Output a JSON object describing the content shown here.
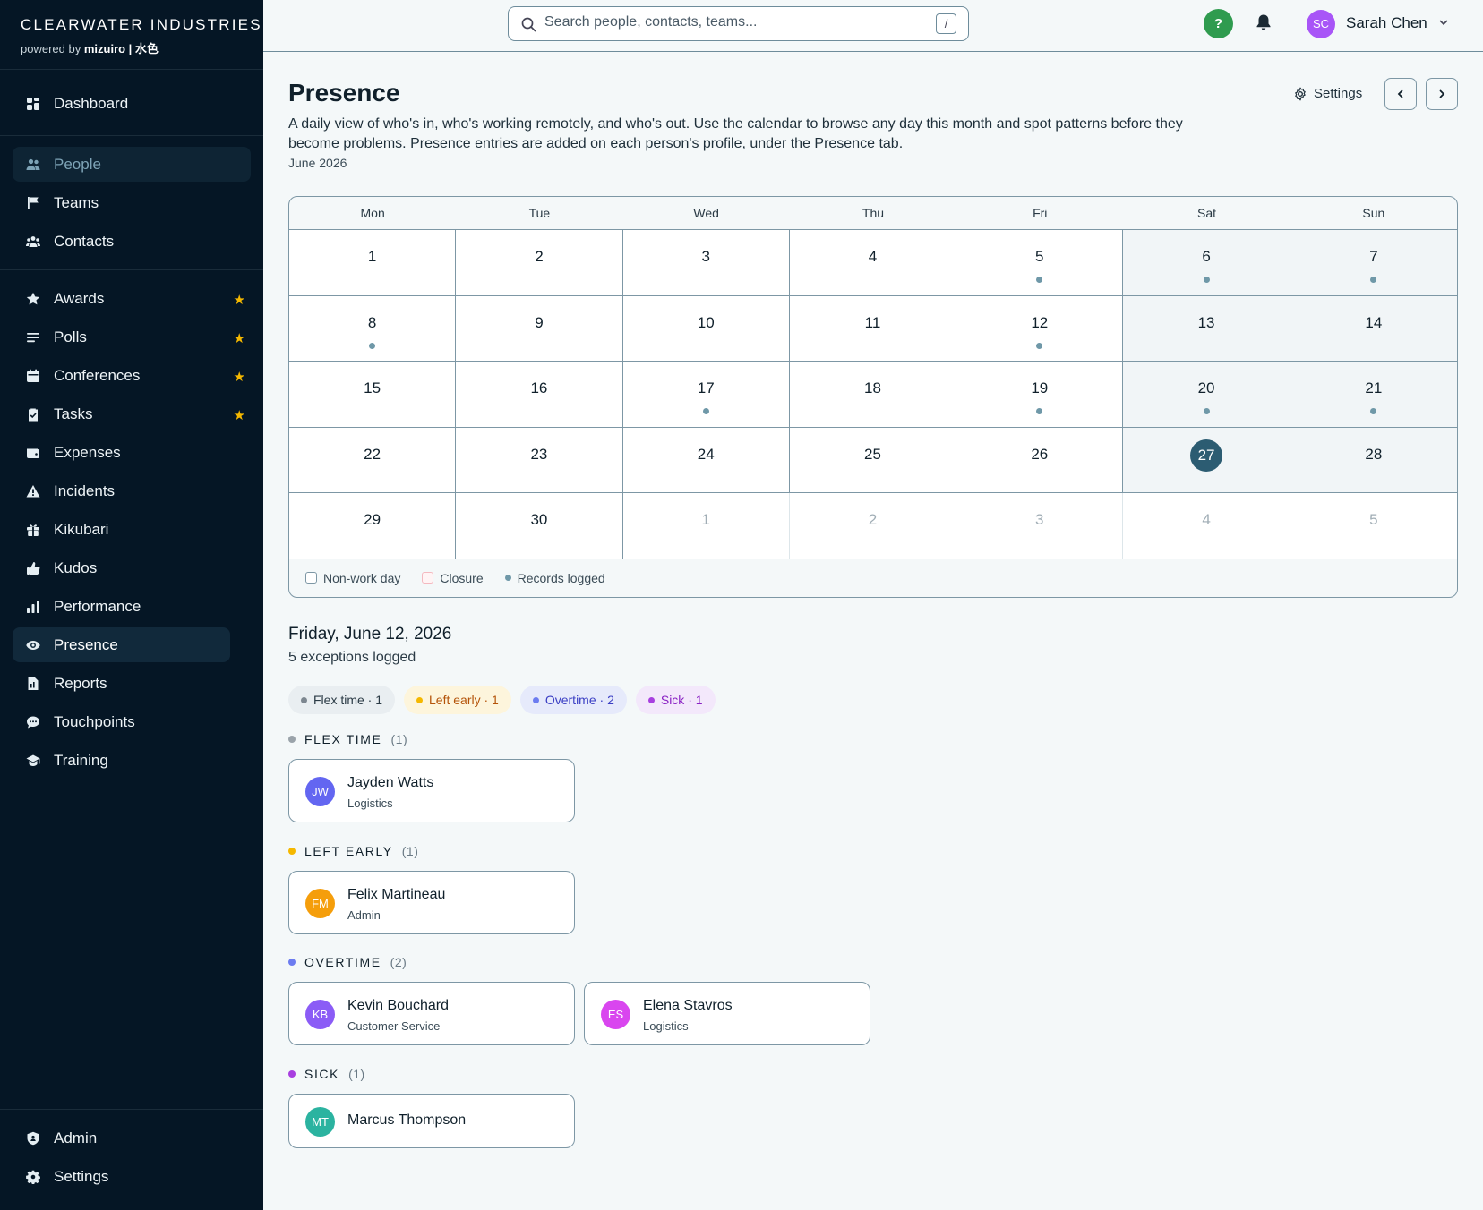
{
  "brand": {
    "name": "CLEARWATER INDUSTRIES",
    "powered_prefix": "powered by",
    "powered_name": "mizuiro | 水色"
  },
  "sidebar": {
    "top": [
      {
        "label": "Dashboard",
        "icon": "dashboard-icon"
      }
    ],
    "main": [
      {
        "label": "People",
        "icon": "people-icon"
      },
      {
        "label": "Teams",
        "icon": "flag-icon"
      },
      {
        "label": "Contacts",
        "icon": "contacts-icon"
      }
    ],
    "modules": [
      {
        "label": "Awards",
        "icon": "star-icon",
        "starred": true
      },
      {
        "label": "Polls",
        "icon": "list-icon",
        "starred": true
      },
      {
        "label": "Conferences",
        "icon": "calendar-icon",
        "starred": true
      },
      {
        "label": "Tasks",
        "icon": "clipboard-icon",
        "starred": true
      },
      {
        "label": "Expenses",
        "icon": "wallet-icon",
        "starred": false
      },
      {
        "label": "Incidents",
        "icon": "warning-icon",
        "starred": false
      },
      {
        "label": "Kikubari",
        "icon": "gift-icon",
        "starred": false
      },
      {
        "label": "Kudos",
        "icon": "thumbs-up-icon",
        "starred": false
      },
      {
        "label": "Performance",
        "icon": "bar-chart-icon",
        "starred": false
      },
      {
        "label": "Presence",
        "icon": "eye-icon",
        "starred": false,
        "active": true
      },
      {
        "label": "Reports",
        "icon": "report-icon",
        "starred": false
      },
      {
        "label": "Touchpoints",
        "icon": "chat-icon",
        "starred": false
      },
      {
        "label": "Training",
        "icon": "graduation-cap-icon",
        "starred": false
      }
    ],
    "bottom": [
      {
        "label": "Admin",
        "icon": "shield-icon"
      },
      {
        "label": "Settings",
        "icon": "gear-icon"
      }
    ]
  },
  "topbar": {
    "search_placeholder": "Search people, contacts, teams...",
    "search_shortcut": "/",
    "help_label": "?",
    "user_initials": "SC",
    "user_name": "Sarah Chen"
  },
  "page": {
    "title": "Presence",
    "description": "A daily view of who's in, who's working remotely, and who's out. Use the calendar to browse any day this month and spot patterns before they become problems. Presence entries are added on each person's profile, under the Presence tab.",
    "month": "June 2026",
    "settings_label": "Settings"
  },
  "calendar": {
    "weekdays": [
      "Mon",
      "Tue",
      "Wed",
      "Thu",
      "Fri",
      "Sat",
      "Sun"
    ],
    "days": [
      {
        "n": "1"
      },
      {
        "n": "2"
      },
      {
        "n": "3"
      },
      {
        "n": "4"
      },
      {
        "n": "5",
        "dot": true
      },
      {
        "n": "6",
        "dot": true,
        "weekend": true
      },
      {
        "n": "7",
        "dot": true,
        "weekend": true
      },
      {
        "n": "8",
        "dot": true
      },
      {
        "n": "9"
      },
      {
        "n": "10"
      },
      {
        "n": "11"
      },
      {
        "n": "12",
        "dot": true
      },
      {
        "n": "13",
        "weekend": true
      },
      {
        "n": "14",
        "weekend": true
      },
      {
        "n": "15"
      },
      {
        "n": "16"
      },
      {
        "n": "17",
        "dot": true
      },
      {
        "n": "18"
      },
      {
        "n": "19",
        "dot": true
      },
      {
        "n": "20",
        "dot": true,
        "weekend": true
      },
      {
        "n": "21",
        "dot": true,
        "weekend": true
      },
      {
        "n": "22"
      },
      {
        "n": "23"
      },
      {
        "n": "24"
      },
      {
        "n": "25"
      },
      {
        "n": "26"
      },
      {
        "n": "27",
        "today": true,
        "weekend": true
      },
      {
        "n": "28",
        "weekend": true
      },
      {
        "n": "29"
      },
      {
        "n": "30"
      },
      {
        "n": "1",
        "other": true
      },
      {
        "n": "2",
        "other": true
      },
      {
        "n": "3",
        "other": true
      },
      {
        "n": "4",
        "other": true
      },
      {
        "n": "5",
        "other": true
      }
    ],
    "legend": {
      "nonwork": "Non-work day",
      "closure": "Closure",
      "records": "Records logged"
    }
  },
  "selected_day": {
    "title": "Friday, June 12, 2026",
    "subtitle": "5 exceptions logged",
    "chips": [
      {
        "label": "Flex time · 1",
        "dot": "#7d8790",
        "bg": "#e9eef1",
        "fg": "#2a3a45"
      },
      {
        "label": "Left early · 1",
        "dot": "#f5b800",
        "bg": "#fdf5dc",
        "fg": "#b45309"
      },
      {
        "label": "Overtime · 2",
        "dot": "#6c7cf0",
        "bg": "#e6eafb",
        "fg": "#3b3fc4"
      },
      {
        "label": "Sick · 1",
        "dot": "#a83fe0",
        "bg": "#f3e8fb",
        "fg": "#8a22c4"
      }
    ],
    "groups": [
      {
        "title": "FLEX TIME",
        "count": "(1)",
        "dot": "#9aa3aa",
        "people": [
          {
            "initials": "JW",
            "name": "Jayden Watts",
            "dept": "Logistics",
            "color": "#6366f1"
          }
        ]
      },
      {
        "title": "LEFT EARLY",
        "count": "(1)",
        "dot": "#f5b800",
        "people": [
          {
            "initials": "FM",
            "name": "Felix Martineau",
            "dept": "Admin",
            "color": "#f59e0b"
          }
        ]
      },
      {
        "title": "OVERTIME",
        "count": "(2)",
        "dot": "#6c7cf0",
        "people": [
          {
            "initials": "KB",
            "name": "Kevin Bouchard",
            "dept": "Customer Service",
            "color": "#8b5cf6"
          },
          {
            "initials": "ES",
            "name": "Elena Stavros",
            "dept": "Logistics",
            "color": "#d946ef"
          }
        ]
      },
      {
        "title": "SICK",
        "count": "(1)",
        "dot": "#a83fe0",
        "people": [
          {
            "initials": "MT",
            "name": "Marcus Thompson",
            "dept": "",
            "color": "#2bb3a0"
          }
        ]
      }
    ]
  }
}
